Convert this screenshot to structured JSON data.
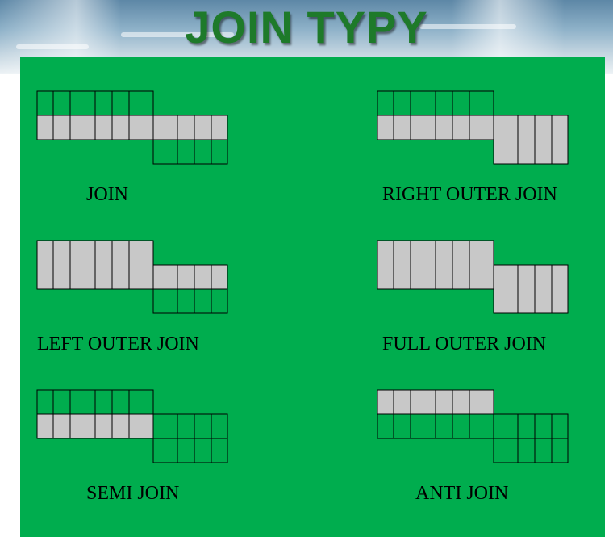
{
  "title": "JOIN TYPY",
  "colors": {
    "panel": "#00ad4e",
    "filled": "#c8c8c8",
    "stroke": "#000000",
    "title": "#1e7a2a"
  },
  "joins": [
    {
      "id": "join",
      "label": "JOIN",
      "top_cols": 6,
      "bottom_cols": 4,
      "left_fill": "matched",
      "right_fill": "matched"
    },
    {
      "id": "right-outer-join",
      "label": "RIGHT OUTER JOIN",
      "top_cols": 6,
      "bottom_cols": 4,
      "left_fill": "matched",
      "right_fill": "full"
    },
    {
      "id": "left-outer-join",
      "label": "LEFT OUTER JOIN",
      "top_cols": 6,
      "bottom_cols": 4,
      "left_fill": "full",
      "right_fill": "matched"
    },
    {
      "id": "full-outer-join",
      "label": "FULL OUTER JOIN",
      "top_cols": 6,
      "bottom_cols": 4,
      "left_fill": "full",
      "right_fill": "full"
    },
    {
      "id": "semi-join",
      "label": "SEMI JOIN",
      "top_cols": 6,
      "bottom_cols": 4,
      "left_fill": "matched",
      "right_fill": "none"
    },
    {
      "id": "anti-join",
      "label": "ANTI JOIN",
      "top_cols": 6,
      "bottom_cols": 4,
      "left_fill": "unmatched",
      "right_fill": "none"
    }
  ]
}
